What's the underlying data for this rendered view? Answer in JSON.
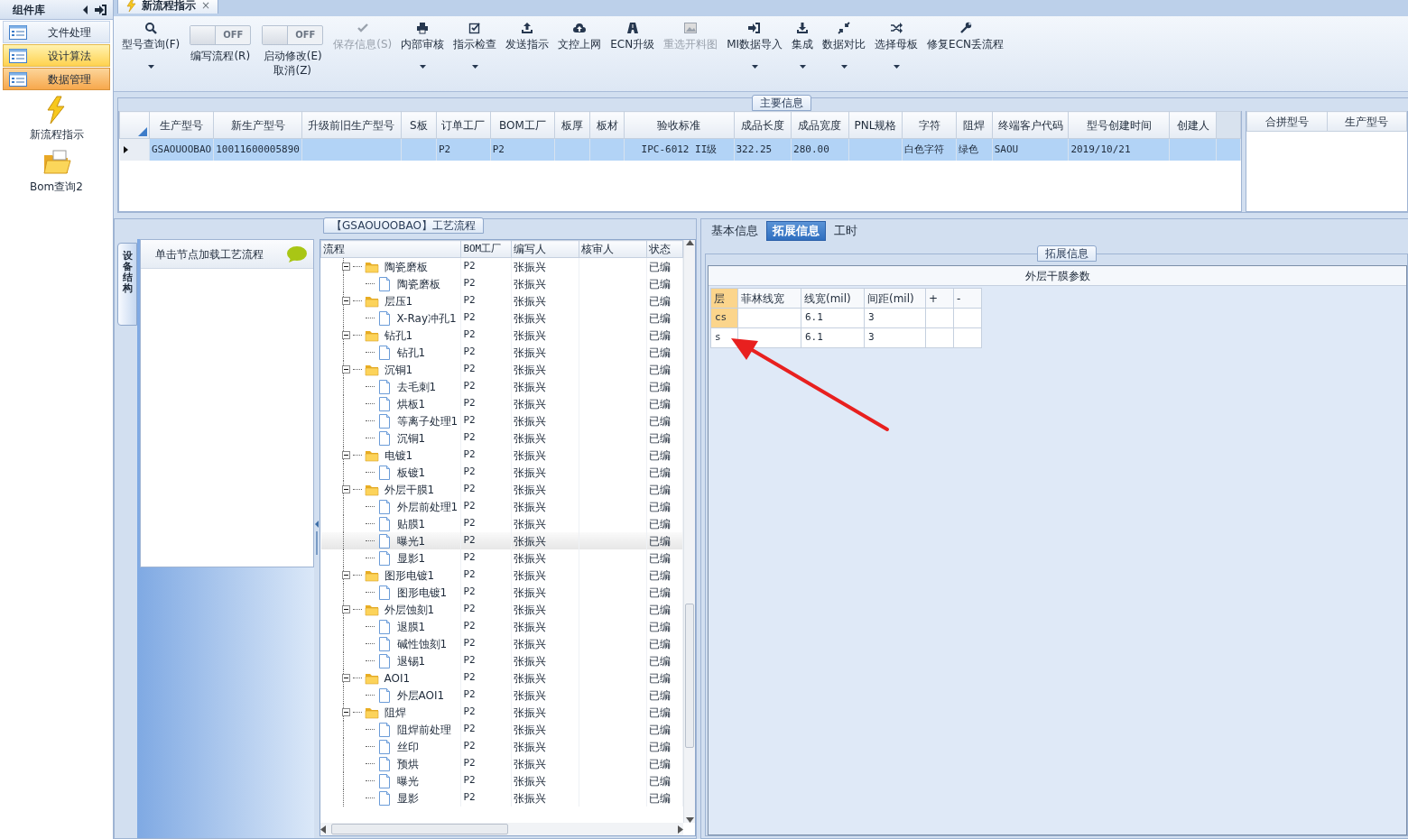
{
  "sidebar": {
    "title": "组件库",
    "items": [
      {
        "label": "文件处理",
        "selected": false,
        "hovered": false
      },
      {
        "label": "设计算法",
        "selected": false,
        "hovered": true
      },
      {
        "label": "数据管理",
        "selected": true,
        "hovered": false
      }
    ],
    "shortcuts": [
      {
        "label": "新流程指示"
      },
      {
        "label": "Bom查询2"
      }
    ]
  },
  "document_tab": {
    "title": "新流程指示",
    "close": "×"
  },
  "toolbar": [
    {
      "kind": "button",
      "label": "型号查询(F)",
      "dropdown": true,
      "disabled": false
    },
    {
      "kind": "toggle",
      "text": "OFF",
      "on": false,
      "label": "编写流程(R)"
    },
    {
      "kind": "toggle",
      "text": "OFF",
      "on": false,
      "label": "启动修改(E)",
      "sublabel": "取消(Z)"
    },
    {
      "kind": "button",
      "label": "保存信息(S)",
      "dropdown": false,
      "disabled": true
    },
    {
      "kind": "button",
      "label": "内部审核",
      "dropdown": true,
      "disabled": false
    },
    {
      "kind": "button",
      "label": "指示检查",
      "dropdown": true,
      "disabled": false
    },
    {
      "kind": "button",
      "label": "发送指示",
      "dropdown": false,
      "disabled": false
    },
    {
      "kind": "button",
      "label": "文控上网",
      "dropdown": false,
      "disabled": false
    },
    {
      "kind": "button",
      "label": "ECN升级",
      "dropdown": false,
      "disabled": false
    },
    {
      "kind": "button",
      "label": "重选开料图",
      "dropdown": false,
      "disabled": true
    },
    {
      "kind": "button",
      "label": "MI数据导入",
      "dropdown": true,
      "disabled": false
    },
    {
      "kind": "button",
      "label": "集成",
      "dropdown": true,
      "disabled": false
    },
    {
      "kind": "button",
      "label": "数据对比",
      "dropdown": true,
      "disabled": false
    },
    {
      "kind": "button",
      "label": "选择母板",
      "dropdown": true,
      "disabled": false
    },
    {
      "kind": "button",
      "label": "修复ECN丢流程",
      "dropdown": false,
      "disabled": false
    }
  ],
  "main_info": {
    "title": "主要信息",
    "table": {
      "columns": [
        "生产型号",
        "新生产型号",
        "升级前旧生产型号",
        "S板",
        "订单工厂",
        "BOM工厂",
        "板厚",
        "板材",
        "验收标准",
        "成品长度",
        "成品宽度",
        "PNL规格",
        "字符",
        "阻焊",
        "终端客户代码",
        "型号创建时间",
        "创建人"
      ],
      "rows": [
        {
          "selected": true,
          "cells": [
            "GSAOUOOBAO",
            "10011600005890",
            "",
            "",
            "P2",
            "P2",
            "",
            "",
            "IPC-6012 II级",
            "322.25",
            "280.00",
            "",
            "白色字符",
            "绿色",
            "SAOU",
            "2019/10/21",
            ""
          ]
        }
      ]
    },
    "side_table": {
      "columns": [
        "合拼型号",
        "生产型号"
      ]
    }
  },
  "device_panel": {
    "tab": "设备结构",
    "hint": "单击节点加载工艺流程"
  },
  "process_tree": {
    "title": "【GSAOUOOBAO】工艺流程",
    "columns": [
      "流程",
      "BOM工厂",
      "编写人",
      "核审人",
      "状态"
    ],
    "nodes": [
      {
        "name": "陶瓷磨板",
        "bom": "P2",
        "writer": "张振兴",
        "status": "已编",
        "expanded": true,
        "selected": false,
        "children": [
          {
            "name": "陶瓷磨板",
            "bom": "P2",
            "writer": "张振兴",
            "status": "已编",
            "selected": false
          }
        ]
      },
      {
        "name": "层压1",
        "bom": "P2",
        "writer": "张振兴",
        "status": "已编",
        "expanded": true,
        "selected": false,
        "children": [
          {
            "name": "X-Ray冲孔1",
            "bom": "P2",
            "writer": "张振兴",
            "status": "已编",
            "selected": false
          }
        ]
      },
      {
        "name": "钻孔1",
        "bom": "P2",
        "writer": "张振兴",
        "status": "已编",
        "expanded": true,
        "selected": false,
        "children": [
          {
            "name": "钻孔1",
            "bom": "P2",
            "writer": "张振兴",
            "status": "已编",
            "selected": false
          }
        ]
      },
      {
        "name": "沉铜1",
        "bom": "P2",
        "writer": "张振兴",
        "status": "已编",
        "expanded": true,
        "selected": false,
        "children": [
          {
            "name": "去毛刺1",
            "bom": "P2",
            "writer": "张振兴",
            "status": "已编",
            "selected": false
          },
          {
            "name": "烘板1",
            "bom": "P2",
            "writer": "张振兴",
            "status": "已编",
            "selected": false
          },
          {
            "name": "等离子处理1",
            "bom": "P2",
            "writer": "张振兴",
            "status": "已编",
            "selected": false
          },
          {
            "name": "沉铜1",
            "bom": "P2",
            "writer": "张振兴",
            "status": "已编",
            "selected": false
          }
        ]
      },
      {
        "name": "电镀1",
        "bom": "P2",
        "writer": "张振兴",
        "status": "已编",
        "expanded": true,
        "selected": false,
        "children": [
          {
            "name": "板镀1",
            "bom": "P2",
            "writer": "张振兴",
            "status": "已编",
            "selected": false
          }
        ]
      },
      {
        "name": "外层干膜1",
        "bom": "P2",
        "writer": "张振兴",
        "status": "已编",
        "expanded": true,
        "selected": false,
        "children": [
          {
            "name": "外层前处理1",
            "bom": "P2",
            "writer": "张振兴",
            "status": "已编",
            "selected": false
          },
          {
            "name": "贴膜1",
            "bom": "P2",
            "writer": "张振兴",
            "status": "已编",
            "selected": false
          },
          {
            "name": "曝光1",
            "bom": "P2",
            "writer": "张振兴",
            "status": "已编",
            "selected": true
          },
          {
            "name": "显影1",
            "bom": "P2",
            "writer": "张振兴",
            "status": "已编",
            "selected": false
          }
        ]
      },
      {
        "name": "图形电镀1",
        "bom": "P2",
        "writer": "张振兴",
        "status": "已编",
        "expanded": true,
        "selected": false,
        "children": [
          {
            "name": "图形电镀1",
            "bom": "P2",
            "writer": "张振兴",
            "status": "已编",
            "selected": false
          }
        ]
      },
      {
        "name": "外层蚀刻1",
        "bom": "P2",
        "writer": "张振兴",
        "status": "已编",
        "expanded": true,
        "selected": false,
        "children": [
          {
            "name": "退膜1",
            "bom": "P2",
            "writer": "张振兴",
            "status": "已编",
            "selected": false
          },
          {
            "name": "碱性蚀刻1",
            "bom": "P2",
            "writer": "张振兴",
            "status": "已编",
            "selected": false
          },
          {
            "name": "退锡1",
            "bom": "P2",
            "writer": "张振兴",
            "status": "已编",
            "selected": false
          }
        ]
      },
      {
        "name": "AOI1",
        "bom": "P2",
        "writer": "张振兴",
        "status": "已编",
        "expanded": true,
        "selected": false,
        "children": [
          {
            "name": "外层AOI1",
            "bom": "P2",
            "writer": "张振兴",
            "status": "已编",
            "selected": false
          }
        ]
      },
      {
        "name": "阻焊",
        "bom": "P2",
        "writer": "张振兴",
        "status": "已编",
        "expanded": true,
        "selected": false,
        "children": [
          {
            "name": "阻焊前处理",
            "bom": "P2",
            "writer": "张振兴",
            "status": "已编",
            "selected": false
          },
          {
            "name": "丝印",
            "bom": "P2",
            "writer": "张振兴",
            "status": "已编",
            "selected": false
          },
          {
            "name": "预烘",
            "bom": "P2",
            "writer": "张振兴",
            "status": "已编",
            "selected": false
          },
          {
            "name": "曝光",
            "bom": "P2",
            "writer": "张振兴",
            "status": "已编",
            "selected": false
          },
          {
            "name": "显影",
            "bom": "P2",
            "writer": "张振兴",
            "status": "已编",
            "selected": false
          }
        ]
      }
    ]
  },
  "detail_tabs": [
    {
      "label": "基本信息",
      "selected": false
    },
    {
      "label": "拓展信息",
      "selected": true
    },
    {
      "label": "工时",
      "selected": false
    }
  ],
  "extended_info": {
    "title": "拓展信息",
    "panel_title": "外层干膜参数",
    "columns": [
      "层",
      "菲林线宽",
      "线宽(mil)",
      "间距(mil)",
      "+",
      "-"
    ],
    "rows": [
      {
        "cells": [
          "cs",
          "",
          "6.1",
          "3",
          "",
          ""
        ],
        "selected": true
      },
      {
        "cells": [
          "s",
          "",
          "6.1",
          "3",
          "",
          ""
        ],
        "selected": false
      }
    ]
  }
}
